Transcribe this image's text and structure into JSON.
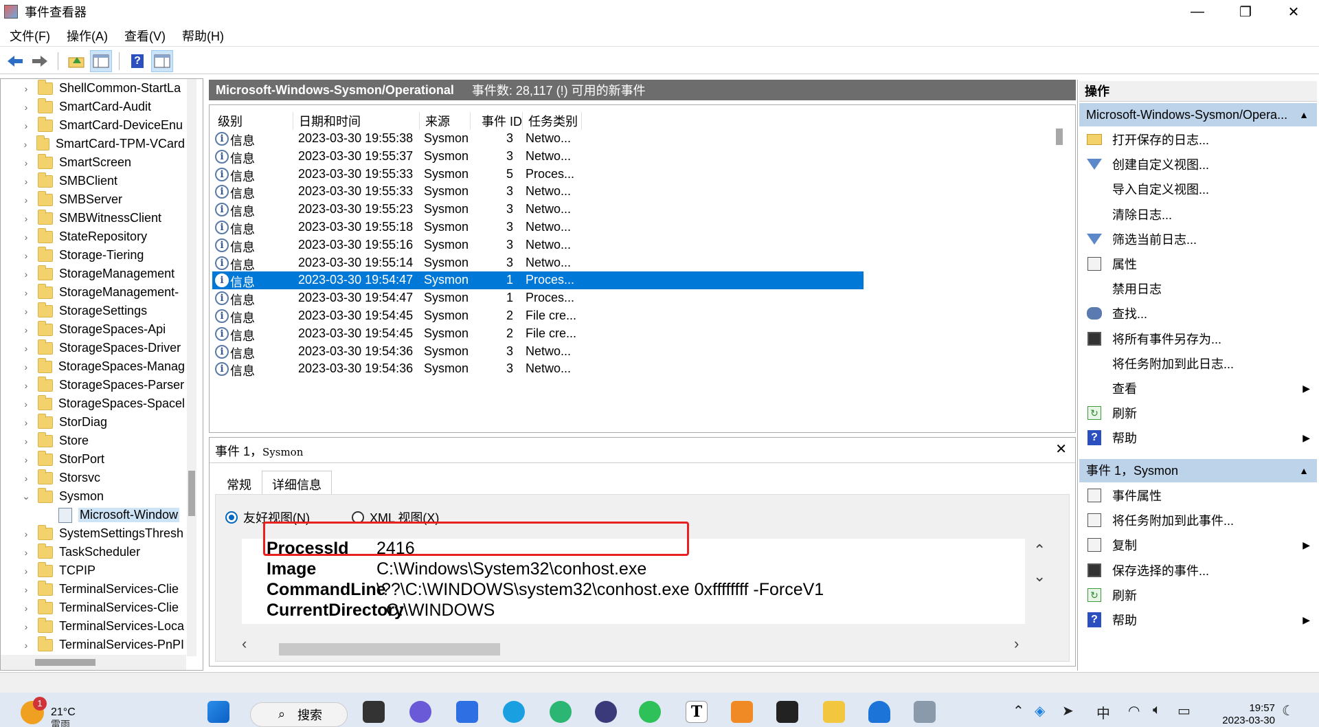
{
  "window": {
    "title": "事件查看器",
    "minimize": "—",
    "maximize": "❐",
    "close": "✕"
  },
  "menu": [
    "文件(F)",
    "操作(A)",
    "查看(V)",
    "帮助(H)"
  ],
  "tree": {
    "items": [
      "ShellCommon-StartLa",
      "SmartCard-Audit",
      "SmartCard-DeviceEnu",
      "SmartCard-TPM-VCard",
      "SmartScreen",
      "SMBClient",
      "SMBServer",
      "SMBWitnessClient",
      "StateRepository",
      "Storage-Tiering",
      "StorageManagement",
      "StorageManagement-",
      "StorageSettings",
      "StorageSpaces-Api",
      "StorageSpaces-Driver",
      "StorageSpaces-Manag",
      "StorageSpaces-Parser",
      "StorageSpaces-Spacel",
      "StorDiag",
      "Store",
      "StorPort",
      "Storsvc",
      "Sysmon"
    ],
    "child": "Microsoft-Window",
    "after": [
      "SystemSettingsThresh",
      "TaskScheduler",
      "TCPIP",
      "TerminalServices-Clie",
      "TerminalServices-Clie",
      "TerminalServices-Loca",
      "TerminalServices-PnPI"
    ]
  },
  "log": {
    "name": "Microsoft-Windows-Sysmon/Operational",
    "count": "事件数: 28,117 (!) 可用的新事件"
  },
  "columns": {
    "level": "级别",
    "datetime": "日期和时间",
    "source": "来源",
    "eventid": "事件 ID",
    "category": "任务类别"
  },
  "events": [
    {
      "level": "信息",
      "datetime": "2023-03-30 19:55:38",
      "source": "Sysmon",
      "id": "3",
      "category": "Netwo..."
    },
    {
      "level": "信息",
      "datetime": "2023-03-30 19:55:37",
      "source": "Sysmon",
      "id": "3",
      "category": "Netwo..."
    },
    {
      "level": "信息",
      "datetime": "2023-03-30 19:55:33",
      "source": "Sysmon",
      "id": "5",
      "category": "Proces..."
    },
    {
      "level": "信息",
      "datetime": "2023-03-30 19:55:33",
      "source": "Sysmon",
      "id": "3",
      "category": "Netwo..."
    },
    {
      "level": "信息",
      "datetime": "2023-03-30 19:55:23",
      "source": "Sysmon",
      "id": "3",
      "category": "Netwo..."
    },
    {
      "level": "信息",
      "datetime": "2023-03-30 19:55:18",
      "source": "Sysmon",
      "id": "3",
      "category": "Netwo..."
    },
    {
      "level": "信息",
      "datetime": "2023-03-30 19:55:16",
      "source": "Sysmon",
      "id": "3",
      "category": "Netwo..."
    },
    {
      "level": "信息",
      "datetime": "2023-03-30 19:55:14",
      "source": "Sysmon",
      "id": "3",
      "category": "Netwo..."
    },
    {
      "level": "信息",
      "datetime": "2023-03-30 19:54:47",
      "source": "Sysmon",
      "id": "1",
      "category": "Proces...",
      "selected": true
    },
    {
      "level": "信息",
      "datetime": "2023-03-30 19:54:47",
      "source": "Sysmon",
      "id": "1",
      "category": "Proces..."
    },
    {
      "level": "信息",
      "datetime": "2023-03-30 19:54:45",
      "source": "Sysmon",
      "id": "2",
      "category": "File cre..."
    },
    {
      "level": "信息",
      "datetime": "2023-03-30 19:54:45",
      "source": "Sysmon",
      "id": "2",
      "category": "File cre..."
    },
    {
      "level": "信息",
      "datetime": "2023-03-30 19:54:36",
      "source": "Sysmon",
      "id": "3",
      "category": "Netwo..."
    },
    {
      "level": "信息",
      "datetime": "2023-03-30 19:54:36",
      "source": "Sysmon",
      "id": "3",
      "category": "Netwo..."
    }
  ],
  "detail": {
    "title_prefix": "事件 1，",
    "title_source": "Sysmon",
    "close": "✕",
    "tabs": [
      "常规",
      "详细信息"
    ],
    "active_tab": 1,
    "view_friendly": "友好视图(N)",
    "view_xml": "XML 视图(X)",
    "fields": [
      {
        "key": "ProcessId",
        "value": "2416"
      },
      {
        "key": "Image",
        "value": "C:\\Windows\\System32\\conhost.exe"
      },
      {
        "key": "CommandLine",
        "value": "\\??\\C:\\WINDOWS\\system32\\conhost.exe 0xffffffff -ForceV1"
      },
      {
        "key": "CurrentDirectory",
        "value": "C:\\WINDOWS"
      }
    ],
    "highlight_color": "#e8201f"
  },
  "actions": {
    "header": "操作",
    "section1": "Microsoft-Windows-Sysmon/Opera...",
    "items1": [
      {
        "icon": "open-log-icon",
        "label": "打开保存的日志..."
      },
      {
        "icon": "filter-icon",
        "label": "创建自定义视图..."
      },
      {
        "icon": "",
        "label": "导入自定义视图..."
      },
      {
        "icon": "",
        "label": "清除日志..."
      },
      {
        "icon": "filter-icon",
        "label": "筛选当前日志..."
      },
      {
        "icon": "properties-icon",
        "label": "属性"
      },
      {
        "icon": "",
        "label": "禁用日志"
      },
      {
        "icon": "find-icon",
        "label": "查找..."
      },
      {
        "icon": "save-icon",
        "label": "将所有事件另存为..."
      },
      {
        "icon": "",
        "label": "将任务附加到此日志..."
      },
      {
        "icon": "",
        "label": "查看",
        "submenu": true
      },
      {
        "icon": "refresh-icon",
        "label": "刷新"
      },
      {
        "icon": "help-icon",
        "label": "帮助",
        "submenu": true
      }
    ],
    "section2": "事件 1，Sysmon",
    "items2": [
      {
        "icon": "event-properties-icon",
        "label": "事件属性"
      },
      {
        "icon": "task-icon",
        "label": "将任务附加到此事件..."
      },
      {
        "icon": "copy-icon",
        "label": "复制",
        "submenu": true
      },
      {
        "icon": "save-icon",
        "label": "保存选择的事件..."
      },
      {
        "icon": "refresh-icon",
        "label": "刷新"
      },
      {
        "icon": "help-icon",
        "label": "帮助",
        "submenu": true
      }
    ]
  },
  "taskbar": {
    "weather_temp": "21°C",
    "weather_cond": "雷雨",
    "weather_badge": "1",
    "search": "搜索",
    "ime": "中",
    "time": "19:57",
    "date": "2023-03-30"
  }
}
